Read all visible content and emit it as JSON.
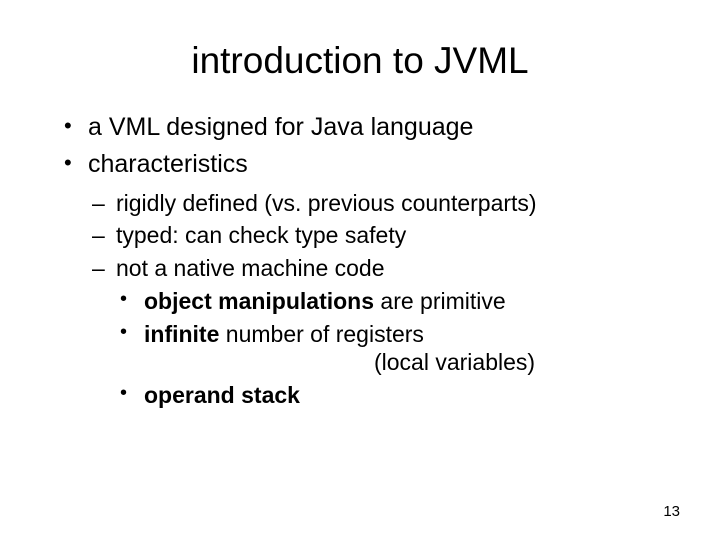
{
  "title": "introduction to JVML",
  "bullets": {
    "b1": "a VML designed for Java language",
    "b2": "characteristics",
    "s1": "rigidly defined (vs. previous counterparts)",
    "s2": "typed: can check type safety",
    "s3": "not a native machine code",
    "t1_bold": "object manipulations",
    "t1_rest": " are primitive",
    "t2_bold": "infinite",
    "t2_rest": " number of registers",
    "t2_sub": "(local variables)",
    "t3_bold": "operand stack"
  },
  "page_number": "13"
}
